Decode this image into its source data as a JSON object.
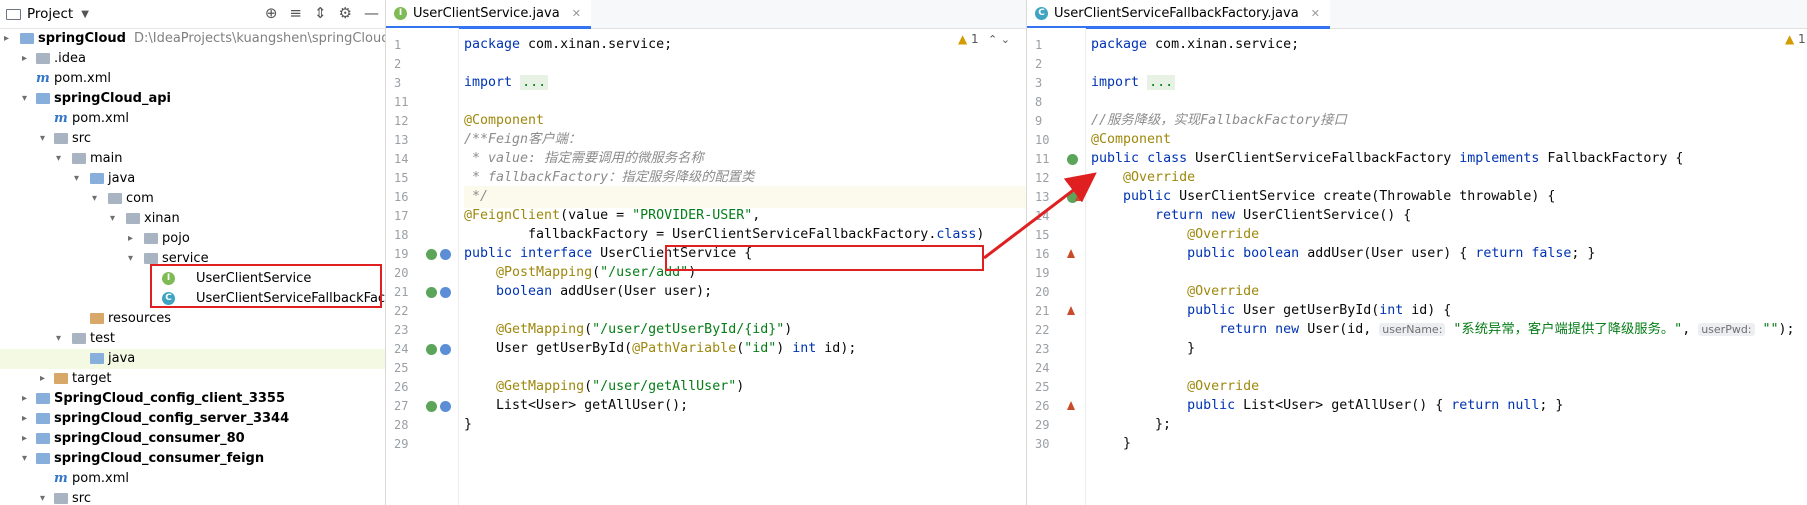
{
  "project_panel": {
    "title": "Project",
    "tree": [
      {
        "label": "springCloud",
        "path": "D:\\IdeaProjects\\kuangshen\\springCloud",
        "bold": true
      },
      {
        "label": ".idea"
      },
      {
        "label": "pom.xml"
      },
      {
        "label": "springCloud_api",
        "bold": true
      },
      {
        "label": "pom.xml"
      },
      {
        "label": "src"
      },
      {
        "label": "main"
      },
      {
        "label": "java"
      },
      {
        "label": "com"
      },
      {
        "label": "xinan"
      },
      {
        "label": "pojo"
      },
      {
        "label": "service"
      },
      {
        "label": "UserClientService",
        "badge": "I"
      },
      {
        "label": "UserClientServiceFallbackFactory",
        "badge": "C"
      },
      {
        "label": "resources"
      },
      {
        "label": "test"
      },
      {
        "label": "java"
      },
      {
        "label": "target"
      },
      {
        "label": "SpringCloud_config_client_3355",
        "bold": true
      },
      {
        "label": "springCloud_config_server_3344",
        "bold": true
      },
      {
        "label": "springCloud_consumer_80",
        "bold": true
      },
      {
        "label": "springCloud_consumer_feign",
        "bold": true
      },
      {
        "label": "pom.xml"
      },
      {
        "label": "src"
      }
    ]
  },
  "editor_left": {
    "tab": "UserClientService.java",
    "tab_badge": "I",
    "warning": "1",
    "lines": [
      {
        "n": "1",
        "code": "package com.xinan.service;"
      },
      {
        "n": "2",
        "code": ""
      },
      {
        "n": "3",
        "code": "import ..."
      },
      {
        "n": "11",
        "code": ""
      },
      {
        "n": "12",
        "code": "@Component"
      },
      {
        "n": "13",
        "code": "/**Feign客户端："
      },
      {
        "n": "14",
        "code": " * value: 指定需要调用的微服务名称"
      },
      {
        "n": "15",
        "code": " * fallbackFactory：指定服务降级的配置类"
      },
      {
        "n": "16",
        "code": " */"
      },
      {
        "n": "17",
        "code": "@FeignClient(value = \"PROVIDER-USER\","
      },
      {
        "n": "18",
        "code": "        fallbackFactory = UserClientServiceFallbackFactory.class)"
      },
      {
        "n": "19",
        "code": "public interface UserClientService {"
      },
      {
        "n": "20",
        "code": "    @PostMapping(\"/user/add\")"
      },
      {
        "n": "21",
        "code": "    boolean addUser(User user);"
      },
      {
        "n": "22",
        "code": ""
      },
      {
        "n": "23",
        "code": "    @GetMapping(\"/user/getUserById/{id}\")"
      },
      {
        "n": "24",
        "code": "    User getUserById(@PathVariable(\"id\") int id);"
      },
      {
        "n": "25",
        "code": ""
      },
      {
        "n": "26",
        "code": "    @GetMapping(\"/user/getAllUser\")"
      },
      {
        "n": "27",
        "code": "    List<User> getAllUser();"
      },
      {
        "n": "28",
        "code": "}"
      },
      {
        "n": "29",
        "code": ""
      }
    ]
  },
  "editor_right": {
    "tab": "UserClientServiceFallbackFactory.java",
    "tab_badge": "C",
    "warning": "1",
    "lines": [
      {
        "n": "1",
        "code": "package com.xinan.service;"
      },
      {
        "n": "2",
        "code": ""
      },
      {
        "n": "3",
        "code": "import ..."
      },
      {
        "n": "8",
        "code": ""
      },
      {
        "n": "9",
        "code": "//服务降级，实现FallbackFactory接口"
      },
      {
        "n": "10",
        "code": "@Component"
      },
      {
        "n": "11",
        "code": "public class UserClientServiceFallbackFactory implements FallbackFactory {"
      },
      {
        "n": "12",
        "code": "    @Override"
      },
      {
        "n": "13",
        "code": "    public UserClientService create(Throwable throwable) {"
      },
      {
        "n": "14",
        "code": "        return new UserClientService() {"
      },
      {
        "n": "15",
        "code": "            @Override"
      },
      {
        "n": "16",
        "code": "            public boolean addUser(User user) { return false; }"
      },
      {
        "n": "19",
        "code": ""
      },
      {
        "n": "20",
        "code": "            @Override"
      },
      {
        "n": "21",
        "code": "            public User getUserById(int id) {"
      },
      {
        "n": "22",
        "code": "                return new User(id, userName: \"系统异常，客户端提供了降级服务。\", userPwd: \"\");"
      },
      {
        "n": "23",
        "code": "            }"
      },
      {
        "n": "24",
        "code": ""
      },
      {
        "n": "25",
        "code": "            @Override"
      },
      {
        "n": "26",
        "code": "            public List<User> getAllUser() { return null; }"
      },
      {
        "n": "29",
        "code": "        };"
      },
      {
        "n": "30",
        "code": "    }"
      }
    ]
  },
  "colors": {
    "keyword": "#0033b3",
    "annotation": "#9e880d",
    "string": "#067d17",
    "comment": "#8c8c8c",
    "highlight_box": "#e02020",
    "arrow": "#e02020"
  }
}
